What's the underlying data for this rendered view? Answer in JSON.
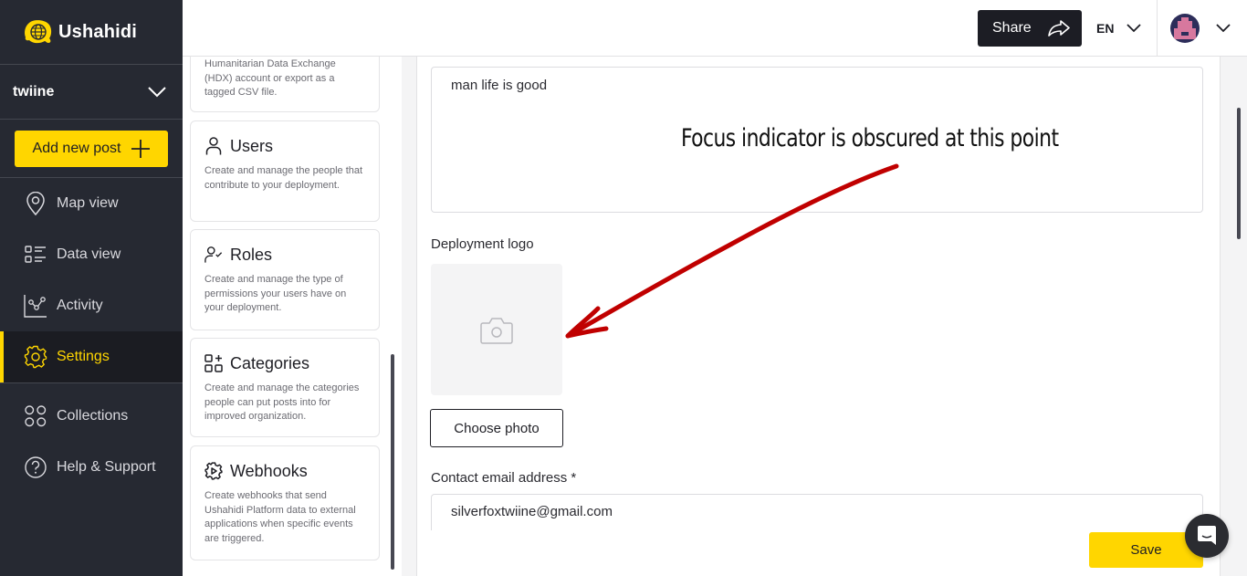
{
  "brand": {
    "name": "Ushahidi",
    "logo_icon": "ushahidi-globe-logo"
  },
  "deployment": {
    "name": "twiine",
    "toggle_icon": "chevron-down-icon"
  },
  "sidebar": {
    "add_post_label": "Add new post",
    "add_post_icon": "plus-icon",
    "items": [
      {
        "label": "Map view",
        "icon": "map-pin-icon",
        "active": false
      },
      {
        "label": "Data view",
        "icon": "list-icon",
        "active": false
      },
      {
        "label": "Activity",
        "icon": "activity-chart-icon",
        "active": false
      },
      {
        "label": "Settings",
        "icon": "gear-icon",
        "active": true
      },
      {
        "label": "Collections",
        "icon": "collections-icon",
        "active": false
      },
      {
        "label": "Help & Support",
        "icon": "help-icon",
        "active": false
      }
    ]
  },
  "topbar": {
    "share_label": "Share",
    "share_icon": "share-arrow-icon",
    "language": "EN",
    "language_icon": "chevron-down-icon",
    "user_menu_icon": "chevron-down-icon"
  },
  "settings_cards": [
    {
      "title": "",
      "description": "Humanitarian Data Exchange (HDX) account or export as a tagged CSV file.",
      "icon": ""
    },
    {
      "title": "Users",
      "description": "Create and manage the people that contribute to your deployment.",
      "icon": "user-icon"
    },
    {
      "title": "Roles",
      "description": "Create and manage the type of permissions your users have on your deployment.",
      "icon": "user-check-icon"
    },
    {
      "title": "Categories",
      "description": "Create and manage the categories people can put posts into for improved organization.",
      "icon": "categories-icon"
    },
    {
      "title": "Webhooks",
      "description": "Create webhooks that send Ushahidi Platform data to external applications when specific events are triggered.",
      "icon": "webhook-gear-icon"
    }
  ],
  "form": {
    "description_value": "man life is good",
    "logo_label": "Deployment logo",
    "logo_placeholder_icon": "camera-icon",
    "choose_photo_label": "Choose photo",
    "email_label": "Contact email address *",
    "email_value": "silverfoxtwiine@gmail.com",
    "save_label": "Save"
  },
  "chat": {
    "icon": "chat-bubble-icon"
  },
  "annotation": {
    "text": "Focus indicator is obscured at this point",
    "color": "#c00000"
  },
  "colors": {
    "accent": "#ffd600",
    "sidebar_bg": "#262932",
    "dark_button": "#1c1d24"
  }
}
